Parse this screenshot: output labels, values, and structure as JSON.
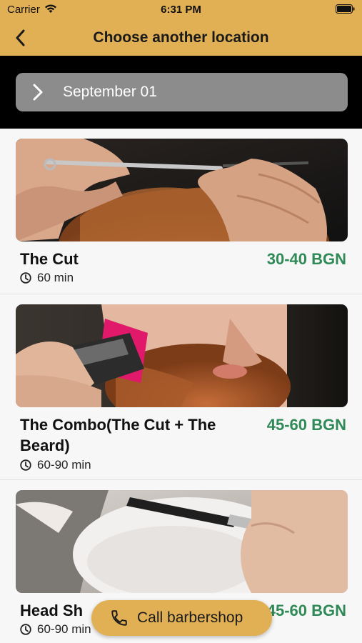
{
  "status_bar": {
    "carrier": "Carrier",
    "time": "6:31 PM"
  },
  "header": {
    "title": "Choose another location",
    "back_icon": "chevron-left-icon"
  },
  "date_selector": {
    "label": "September 01",
    "icon": "chevron-right-icon"
  },
  "services": [
    {
      "name": "The Cut",
      "duration": "60 min",
      "price": "30-40 BGN",
      "image": "haircut-photo"
    },
    {
      "name": "The Combo(The Cut + The Beard)",
      "duration": "60-90 min",
      "price": "45-60 BGN",
      "image": "beard-trim-photo"
    },
    {
      "name": "Head Shave",
      "name_visible": "Head Sh",
      "duration": "60-90 min",
      "price": "45-60 BGN",
      "image": "razor-shave-photo"
    }
  ],
  "call_button": {
    "label": "Call barbershop",
    "icon": "phone-icon"
  },
  "colors": {
    "accent": "#e2b054",
    "price": "#2f8a57",
    "date_pill": "#8c8c8c"
  }
}
